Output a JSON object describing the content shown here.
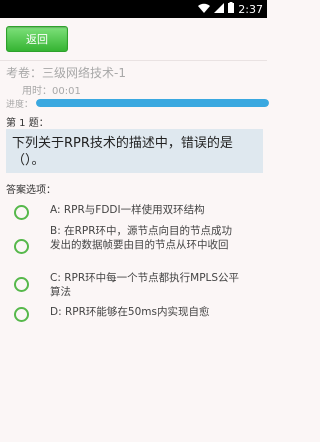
{
  "status": {
    "time": "2:37"
  },
  "toolbar": {
    "back_label": "返回"
  },
  "exam": {
    "title": "考卷：三级网络技术-1",
    "elapsed": "用时：00:01",
    "progress_label": "进度：",
    "progress_fraction": 1.0
  },
  "question": {
    "number": "第 1 题：",
    "text": "下列关于RPR技术的描述中，错误的是（）。"
  },
  "options_label": "答案选项：",
  "options": [
    {
      "text": "A:  RPR与FDDI一样使用双环结构"
    },
    {
      "text": "B:  在RPR环中，源节点向目的节点成功发出的数据帧要由目的节点从环中收回"
    },
    {
      "text": "C:  RPR环中每一个节点都执行MPLS公平算法"
    },
    {
      "text": "D:  RPR环能够在50ms内实现自愈"
    }
  ],
  "colors": {
    "accent": "#35b432",
    "progress": "#3aa8e0",
    "question_bg": "#dfe8ef"
  }
}
